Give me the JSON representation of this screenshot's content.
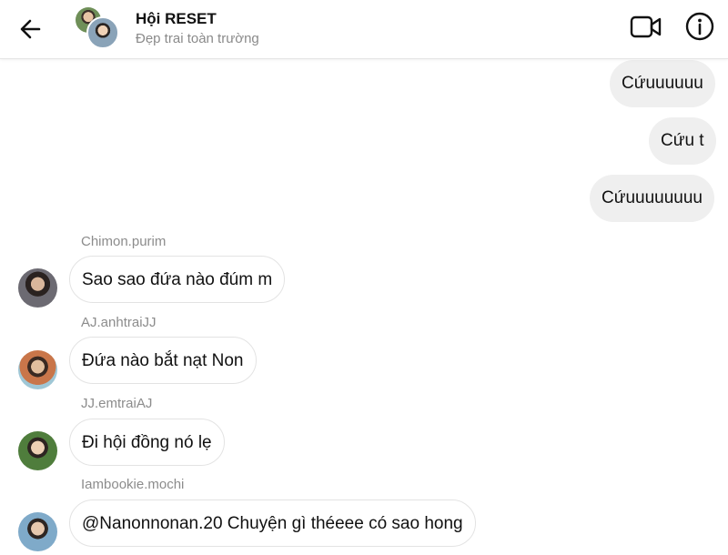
{
  "header": {
    "title": "Hội RESET",
    "subtitle": "Đẹp trai toàn trường",
    "back_icon": "arrow-left-icon",
    "video_icon": "video-camera-icon",
    "info_icon": "info-icon"
  },
  "messages": {
    "sent": [
      {
        "text": "Cứuuuuuu"
      },
      {
        "text": "Cứu t"
      },
      {
        "text": "Cứuuuuuuuu"
      }
    ],
    "received": [
      {
        "sender": "Chimon.purim",
        "text": "Sao sao đứa nào đúm m"
      },
      {
        "sender": "AJ.anhtraiJJ",
        "text": "Đứa nào bắt nạt Non"
      },
      {
        "sender": "JJ.emtraiAJ",
        "text": "Đi hội đồng nó lẹ"
      },
      {
        "sender": "Iambookie.mochi",
        "text": "@Nanonnonan.20 Chuyện gì théeee có sao hong"
      }
    ]
  },
  "colors": {
    "sent_bubble": "#efefef",
    "received_border": "#e3e3e3",
    "secondary_text": "#8a8a8a"
  }
}
